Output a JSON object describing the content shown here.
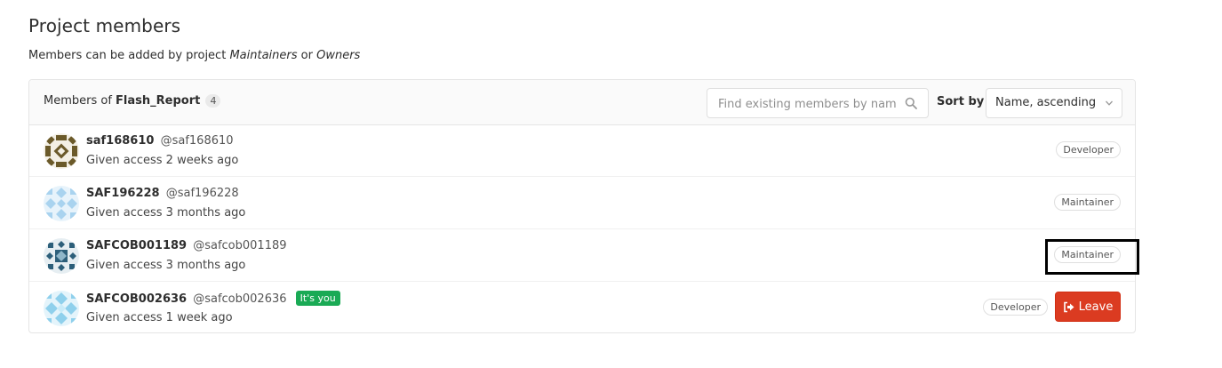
{
  "page": {
    "title": "Project members",
    "subtitle_prefix": "Members can be added by project ",
    "subtitle_role1": "Maintainers",
    "subtitle_or": " or ",
    "subtitle_role2": "Owners"
  },
  "panel": {
    "members_of_label": "Members of ",
    "project_name": "Flash_Report",
    "member_count": "4",
    "search": {
      "placeholder": "Find existing members by name",
      "value": "",
      "icon": "search-icon"
    },
    "sort": {
      "label": "Sort by",
      "selected": "Name, ascending",
      "icon": "chevron-down-icon"
    }
  },
  "members": [
    {
      "name": "saf168610",
      "handle": "@saf168610",
      "access": "Given access 2 weeks ago",
      "role": "Developer"
    },
    {
      "name": "SAF196228",
      "handle": "@saf196228",
      "access": "Given access 3 months ago",
      "role": "Maintainer"
    },
    {
      "name": "SAFCOB001189",
      "handle": "@safcob001189",
      "access": "Given access 3 months ago",
      "role": "Maintainer"
    },
    {
      "name": "SAFCOB002636",
      "handle": "@safcob002636",
      "access": "Given access 1 week ago",
      "role": "Developer",
      "its_you": "It's you",
      "leave_label": "Leave"
    }
  ],
  "colors": {
    "leave_button": "#db3b21",
    "its_you_badge": "#1aaa55",
    "highlight_border": "#000000"
  }
}
